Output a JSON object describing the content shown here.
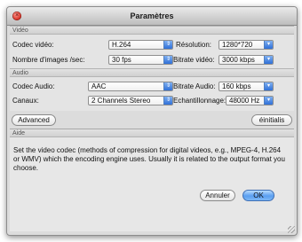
{
  "window": {
    "title": "Paramètres"
  },
  "video": {
    "section_label": "Vidéo",
    "codec_label": "Codec vidéo:",
    "codec_value": "H.264",
    "resolution_label": "Résolution:",
    "resolution_value": "1280*720",
    "framerate_label": "Nombre d'images /sec:",
    "framerate_value": "30 fps",
    "bitrate_label": "Bitrate vidéo:",
    "bitrate_value": "3000 kbps"
  },
  "audio": {
    "section_label": "Audio",
    "codec_label": "Codec Audio:",
    "codec_value": "AAC",
    "bitrate_label": "Bitrate Audio:",
    "bitrate_value": "160 kbps",
    "channels_label": "Canaux:",
    "channels_value": "2 Channels Stereo",
    "samplerate_label": "Echantillonnage:",
    "samplerate_value": "48000 Hz"
  },
  "buttons": {
    "advanced": "Advanced",
    "reset": "éinitialis",
    "cancel": "Annuler",
    "ok": "OK"
  },
  "help": {
    "section_label": "Aide",
    "text": "Set the video codec (methods of compression for digital videos, e.g., MPEG-4, H.264 or WMV) which the encoding engine uses.  Usually it is related to the output format you choose."
  },
  "icons": {
    "close": "close-icon",
    "select_arrow": "up-down-arrows-icon",
    "resize": "resize-grip-icon"
  },
  "colors": {
    "accent": "#2f6fd8",
    "close": "#d8362b",
    "window_bg": "#dcdcdc"
  }
}
